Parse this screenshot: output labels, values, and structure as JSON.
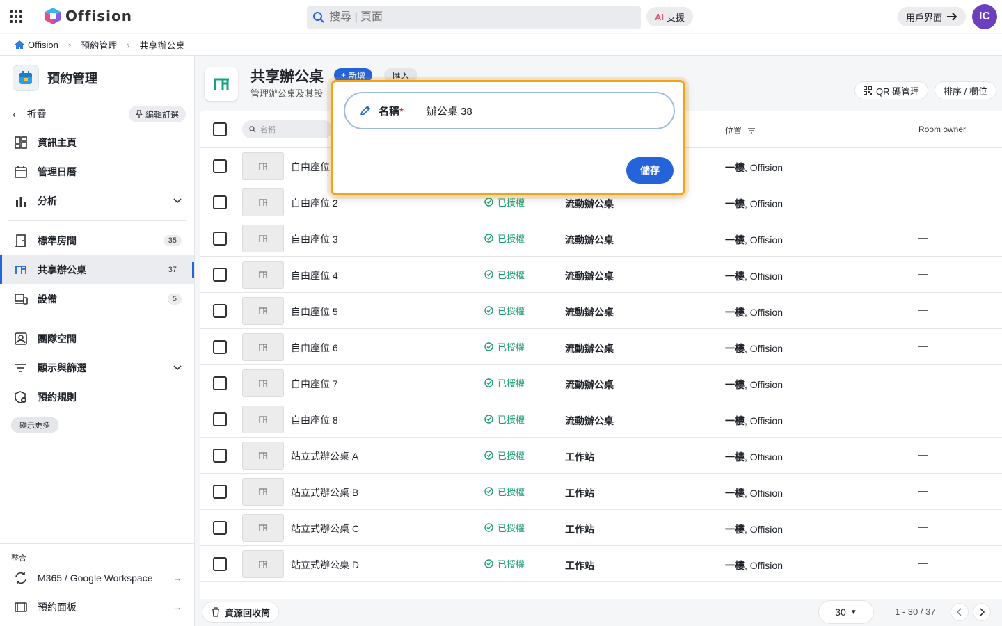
{
  "topbar": {
    "logo_text": "Offision",
    "search_placeholder": "搜尋 | 頁面",
    "ai_prefix": "AI",
    "ai_label": "支援",
    "user_btn": "用戶界面",
    "avatar": "IC"
  },
  "breadcrumb": [
    "Offision",
    "預約管理",
    "共享辦公桌"
  ],
  "sidebar": {
    "title": "預約管理",
    "fold": "折疊",
    "pin": "編輯訂選",
    "items": [
      {
        "label": "資訊主頁"
      },
      {
        "label": "管理日曆"
      },
      {
        "label": "分析"
      },
      {
        "label": "標準房間",
        "badge": "35"
      },
      {
        "label": "共享辦公桌",
        "badge": "37"
      },
      {
        "label": "設備",
        "badge": "5"
      },
      {
        "label": "團隊空間"
      },
      {
        "label": "顯示與篩選"
      },
      {
        "label": "預約規則"
      }
    ],
    "more": "顯示更多",
    "integration_caption": "整合",
    "bottom_items": [
      {
        "label": "M365 / Google Workspace"
      },
      {
        "label": "預約面板"
      }
    ]
  },
  "page": {
    "title": "共享辦公桌",
    "subtitle": "管理辦公桌及其設",
    "add": "新增",
    "import": "匯入",
    "qr": "QR 碼管理",
    "sort": "排序 / 欄位"
  },
  "table": {
    "filter_placeholder": "名稱",
    "col_location": "位置",
    "col_owner": "Room owner",
    "rows": [
      {
        "name": "自由座位",
        "status": "",
        "type": "",
        "loc_floor": "一樓",
        "loc_site": ", Offision",
        "owner": "—"
      },
      {
        "name": "自由座位 2",
        "status": "已授權",
        "type": "流動辦公桌",
        "loc_floor": "一樓",
        "loc_site": ", Offision",
        "owner": "—"
      },
      {
        "name": "自由座位 3",
        "status": "已授權",
        "type": "流動辦公桌",
        "loc_floor": "一樓",
        "loc_site": ", Offision",
        "owner": "—"
      },
      {
        "name": "自由座位 4",
        "status": "已授權",
        "type": "流動辦公桌",
        "loc_floor": "一樓",
        "loc_site": ", Offision",
        "owner": "—"
      },
      {
        "name": "自由座位 5",
        "status": "已授權",
        "type": "流動辦公桌",
        "loc_floor": "一樓",
        "loc_site": ", Offision",
        "owner": "—"
      },
      {
        "name": "自由座位 6",
        "status": "已授權",
        "type": "流動辦公桌",
        "loc_floor": "一樓",
        "loc_site": ", Offision",
        "owner": "—"
      },
      {
        "name": "自由座位 7",
        "status": "已授權",
        "type": "流動辦公桌",
        "loc_floor": "一樓",
        "loc_site": ", Offision",
        "owner": "—"
      },
      {
        "name": "自由座位 8",
        "status": "已授權",
        "type": "流動辦公桌",
        "loc_floor": "一樓",
        "loc_site": ", Offision",
        "owner": "—"
      },
      {
        "name": "站立式辦公桌 A",
        "status": "已授權",
        "type": "工作站",
        "loc_floor": "一樓",
        "loc_site": ", Offision",
        "owner": "—"
      },
      {
        "name": "站立式辦公桌 B",
        "status": "已授權",
        "type": "工作站",
        "loc_floor": "一樓",
        "loc_site": ", Offision",
        "owner": "—"
      },
      {
        "name": "站立式辦公桌 C",
        "status": "已授權",
        "type": "工作站",
        "loc_floor": "一樓",
        "loc_site": ", Offision",
        "owner": "—"
      },
      {
        "name": "站立式辦公桌 D",
        "status": "已授權",
        "type": "工作站",
        "loc_floor": "一樓",
        "loc_site": ", Offision",
        "owner": "—"
      }
    ]
  },
  "footer": {
    "trash": "資源回收筒",
    "page_size": "30",
    "range": "1 - 30 / 37"
  },
  "popup": {
    "label": "名稱",
    "required": "*",
    "value": "辦公桌 38",
    "save": "儲存"
  },
  "colors": {
    "accent": "#2464d8",
    "status": "#1a9e6c",
    "highlight": "#f5a316"
  }
}
